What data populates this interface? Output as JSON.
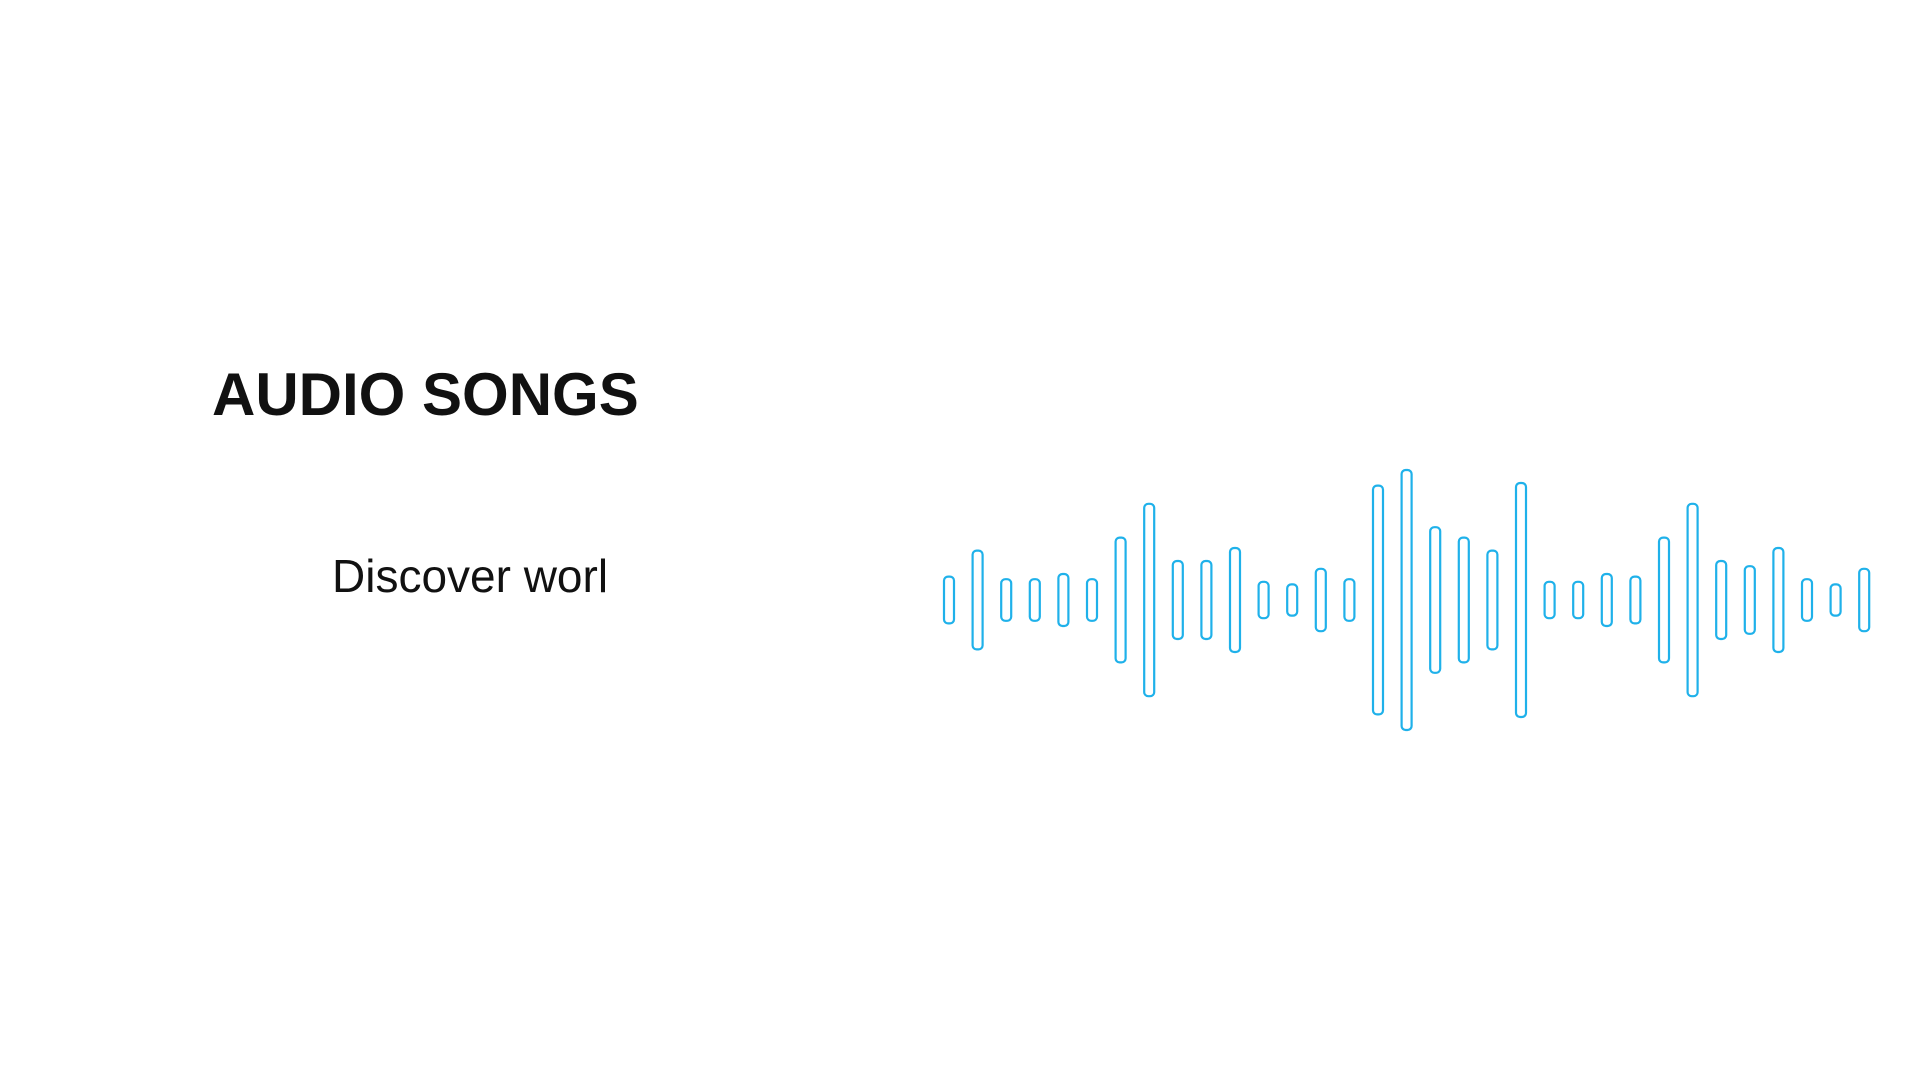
{
  "header": {
    "title": "AUDIO SONGS",
    "subtitle": "Discover worl"
  },
  "waveform": {
    "icon": "soundwave-icon",
    "stroke_color": "#1fb1ea",
    "bar_levels": [
      0.18,
      0.38,
      0.16,
      0.16,
      0.2,
      0.16,
      0.48,
      0.74,
      0.3,
      0.3,
      0.4,
      0.14,
      0.12,
      0.24,
      0.16,
      0.88,
      1.0,
      0.56,
      0.48,
      0.38,
      0.9,
      0.14,
      0.14,
      0.2,
      0.18,
      0.48,
      0.74,
      0.3,
      0.26,
      0.4,
      0.16,
      0.12,
      0.24
    ]
  }
}
